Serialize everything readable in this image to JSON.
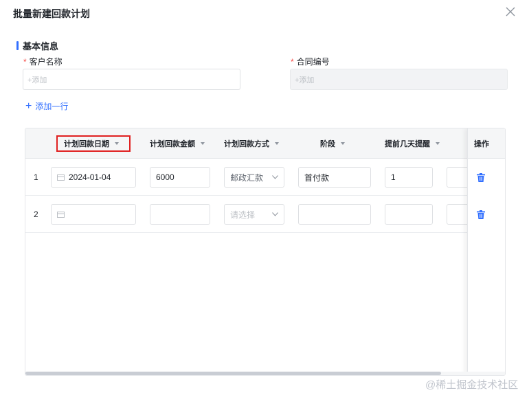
{
  "dialog": {
    "title": "批量新建回款计划"
  },
  "section": {
    "title": "基本信息"
  },
  "form": {
    "customer": {
      "label": "客户名称",
      "placeholder": "+添加"
    },
    "contract": {
      "label": "合同编号",
      "placeholder": "+添加"
    },
    "add_row_label": "添加一行"
  },
  "table": {
    "columns": [
      "计划回款日期",
      "计划回款金额",
      "计划回款方式",
      "阶段",
      "提前几天提醒"
    ],
    "ops_header": "操作",
    "rows": [
      {
        "index": "1",
        "date": "2024-01-04",
        "amount": "6000",
        "method": "邮政汇款",
        "stage": "首付款",
        "remind_days": "1"
      },
      {
        "index": "2",
        "date": "",
        "amount": "",
        "method": "请选择",
        "stage": "",
        "remind_days": ""
      }
    ]
  },
  "watermark": "@稀土掘金技术社区",
  "colors": {
    "accent": "#3370ff",
    "required": "#f54a45",
    "highlight_box": "#e02020"
  }
}
